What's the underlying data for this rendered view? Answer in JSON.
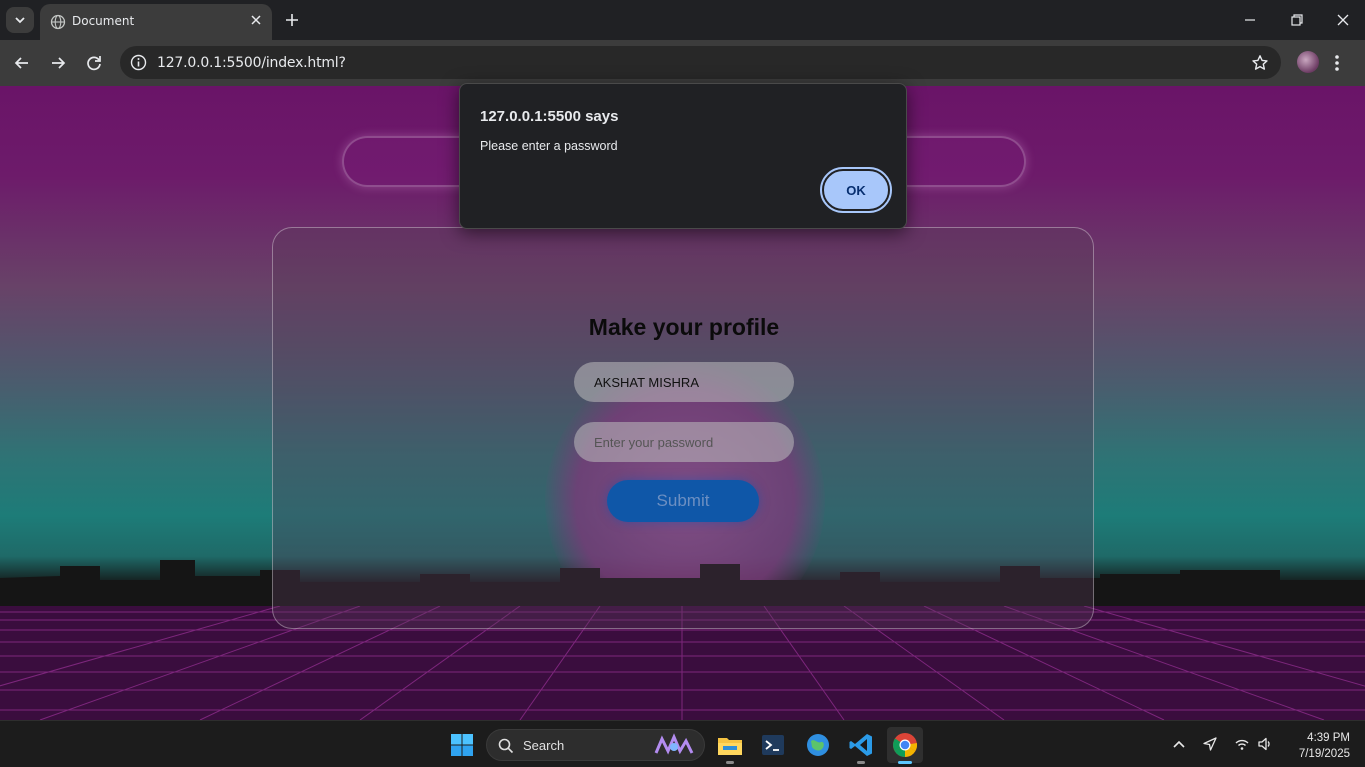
{
  "browser": {
    "tab_title": "Document",
    "url": "127.0.0.1:5500/index.html?"
  },
  "page": {
    "heading": "Make your profile",
    "name_value": "AKSHAT MISHRA",
    "password_placeholder": "Enter your password",
    "submit_label": "Submit"
  },
  "dialog": {
    "title": "127.0.0.1:5500 says",
    "message": "Please enter a password",
    "ok_label": "OK"
  },
  "taskbar": {
    "search_label": "Search",
    "time": "4:39 PM",
    "date": "7/19/2025"
  },
  "icons": [
    "tab-search-icon",
    "globe-icon",
    "close-icon",
    "plus-icon",
    "minimize-icon",
    "restore-icon",
    "back-icon",
    "forward-icon",
    "reload-icon",
    "info-icon",
    "star-icon",
    "kebab-icon",
    "windows-icon",
    "search-icon",
    "file-explorer-icon",
    "terminal-icon",
    "globe-app-icon",
    "vscode-icon",
    "chrome-icon",
    "chevron-up-icon",
    "location-icon",
    "wifi-icon",
    "volume-icon"
  ],
  "colors": {
    "chrome_dark": "#202124",
    "toolbar": "#3c3c3c",
    "ok_button": "#a8c7fa",
    "submit_button": "#0f57a8",
    "page_magenta": "#6a1468",
    "page_teal": "#1d7c78"
  }
}
